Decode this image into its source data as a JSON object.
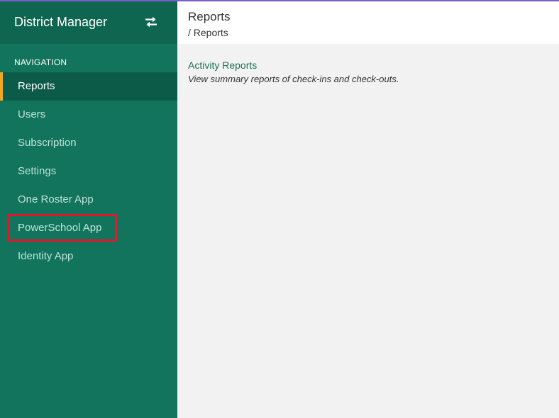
{
  "sidebar": {
    "title": "District Manager",
    "swap_icon": "swap-arrows-icon",
    "nav_heading": "NAVIGATION",
    "items": [
      {
        "label": "Reports",
        "active": true
      },
      {
        "label": "Users"
      },
      {
        "label": "Subscription"
      },
      {
        "label": "Settings"
      },
      {
        "label": "One Roster App"
      },
      {
        "label": "PowerSchool App",
        "highlighted": true
      },
      {
        "label": "Identity App"
      }
    ]
  },
  "header": {
    "title": "Reports",
    "breadcrumb": "/ Reports"
  },
  "content": {
    "link": "Activity Reports",
    "description": "View summary reports of check-ins and check-outs."
  },
  "colors": {
    "sidebar": "#12745c",
    "sidebar_header": "#0f6650",
    "active_item": "#0b5b48",
    "active_indicator": "#f2a81d",
    "highlight_box": "#e0192a",
    "top_accent": "#7b5fc7"
  }
}
